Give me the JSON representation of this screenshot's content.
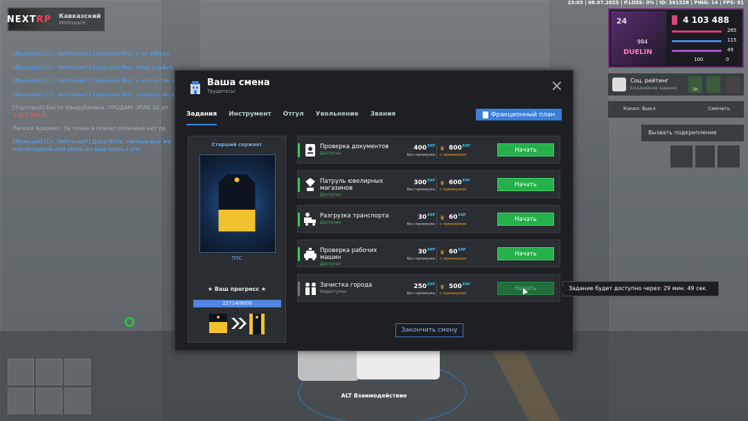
{
  "hud": {
    "status_line": "23:03 | 08.07.2025 | P.LOSS: 0% | ID: 361528 | PING: 14 | FPS: 91",
    "money": "4 103 488",
    "level": "24",
    "avatar_number": "984",
    "avatar_text": "DUELIN",
    "stats": [
      {
        "value": "265",
        "color": "#e0407a"
      },
      {
        "value": "115",
        "color": "#4a8ae8"
      },
      {
        "value": "49",
        "color": "#b050d0"
      }
    ],
    "small_stats": [
      "100",
      "0"
    ],
    "social_rating_title": "Соц. рейтинг",
    "social_rating_sub": "Ежедневное задание",
    "social_rating_value": "3К",
    "channel_label": "Канал: Выкл.",
    "channel_change": "Сменить",
    "call_backup": "Вызвать подкрепление"
  },
  "server": {
    "logo_a": "NEXT",
    "logo_b": "RP",
    "name": "Кавказский",
    "sub": "Workspace"
  },
  "chat": [
    {
      "text": "[Фракция] [Ст. лейтенант] Херанука Янг: я не забуду",
      "color": "blue"
    },
    {
      "text": "[Фракция] [Ст. лейтенант] Херанука Янг: твою улыбку",
      "color": "blue"
    },
    {
      "text": "[Фракция] [Ст. лейтенант] Херанука Янг: и холод так ч",
      "color": "blue"
    },
    {
      "text": "[Фракция] [Ст. лейтенант] Херанука Янг: пройдет по д",
      "color": "blue"
    },
    {
      "text": "[Торговый] Басти Намрубаевна: ПРОДАМ 'ЗРАБ 10 уп",
      "color": "grey"
    },
    {
      "text": "3 375 760 ₽",
      "color": "red"
    },
    {
      "text": "Лапсия Хризмас: За точно я сказал оплачено нет пр",
      "color": "grey"
    },
    {
      "text": "[Фракция] [Ст. лейтенант] Дауд Волк: такеши выу же",
      "color": "blue"
    },
    {
      "text": "нон посадили или уволь он еще связь с опг",
      "color": "blue"
    }
  ],
  "window": {
    "title": "Ваша смена",
    "subtitle": "Трудитесь!",
    "tabs": [
      "Задания",
      "Инструмент",
      "Отгул",
      "Увольнение",
      "Звания"
    ],
    "plan_button": "Фракционный план",
    "finish_button": "Закончить смену"
  },
  "rank": {
    "name": "Старший сержант",
    "unit": "ППС",
    "progress_label": "★ Ваш прогресс ★",
    "progress_text": "22714/9000",
    "progress_fraction": 1.0
  },
  "tasks": [
    {
      "name": "Проверка документов",
      "status": "Доступно",
      "available": true,
      "exp_basic": "400",
      "exp_premium": "800",
      "icon": "document-icon"
    },
    {
      "name": "Патруль ювелирных магазинов",
      "status": "Доступно",
      "available": true,
      "exp_basic": "300",
      "exp_premium": "600",
      "icon": "jewelry-icon"
    },
    {
      "name": "Разгрузка транспорта",
      "status": "Доступно",
      "available": true,
      "exp_basic": "30",
      "exp_premium": "60",
      "icon": "truck-icon"
    },
    {
      "name": "Проверка рабочих машин",
      "status": "Доступно",
      "available": true,
      "exp_basic": "30",
      "exp_premium": "60",
      "icon": "car-icon"
    },
    {
      "name": "Зачистка города",
      "status": "Недоступно",
      "available": false,
      "exp_basic": "250",
      "exp_premium": "500",
      "icon": "officer-icon"
    }
  ],
  "labels": {
    "exp": "EXP",
    "no_premium": "без премиума",
    "with_premium": "с премиумом",
    "start": "Начать"
  },
  "tooltip": "Задание будет доступно через: 29 мин. 49 сек.",
  "interaction_hint": "ALT Взаимодействие"
}
